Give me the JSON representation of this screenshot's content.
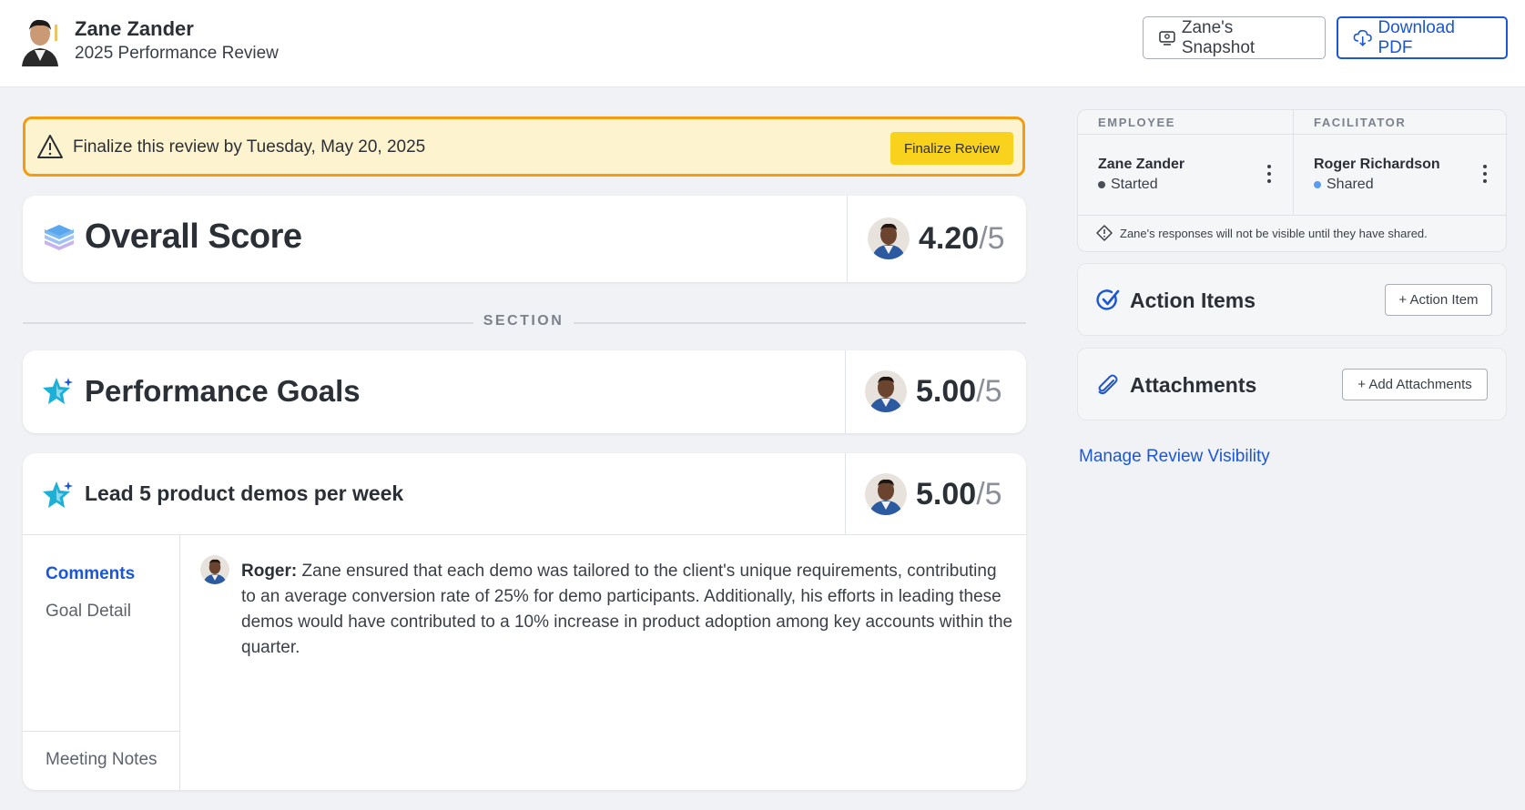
{
  "header": {
    "name": "Zane Zander",
    "subtitle": "2025 Performance Review",
    "snapshot_label": "Zane's Snapshot",
    "download_label": "Download PDF"
  },
  "banner": {
    "text": "Finalize this review by Tuesday, May 20, 2025",
    "button_label": "Finalize Review"
  },
  "overall": {
    "title": "Overall Score",
    "score": "4.20",
    "out_of": "/5"
  },
  "section_label": "SECTION",
  "goals": {
    "title": "Performance Goals",
    "score": "5.00",
    "out_of": "/5"
  },
  "goal_item": {
    "title": "Lead 5 product demos per week",
    "score": "5.00",
    "out_of": "/5",
    "tabs": {
      "comments": "Comments",
      "goal_detail": "Goal Detail",
      "meeting_notes": "Meeting Notes"
    },
    "comment": {
      "author": "Roger:",
      "text": "Zane ensured that each demo was tailored to the client's unique requirements, contributing to an average conversion rate of 25% for demo participants. Additionally, his efforts in leading these demos would have contributed to a 10% increase in product adoption among key accounts within the quarter."
    }
  },
  "participants": {
    "employee": {
      "heading": "EMPLOYEE",
      "name": "Zane Zander",
      "status": "Started",
      "status_color": "#4a4f57"
    },
    "facilitator": {
      "heading": "FACILITATOR",
      "name": "Roger Richardson",
      "status": "Shared",
      "status_color": "#5b9bf0"
    },
    "notice": "Zane's responses will not be visible until they have shared."
  },
  "action_items": {
    "title": "Action Items",
    "button_label": "+ Action Item"
  },
  "attachments": {
    "title": "Attachments",
    "button_label": "+ Add Attachments"
  },
  "manage_visibility_label": "Manage Review Visibility",
  "colors": {
    "accent_blue": "#1a56d6",
    "banner_border": "#f39c12",
    "banner_bg": "#fdf4cf",
    "finalize_yellow": "#f8d21c",
    "star_cyan": "#1ab0d8"
  }
}
